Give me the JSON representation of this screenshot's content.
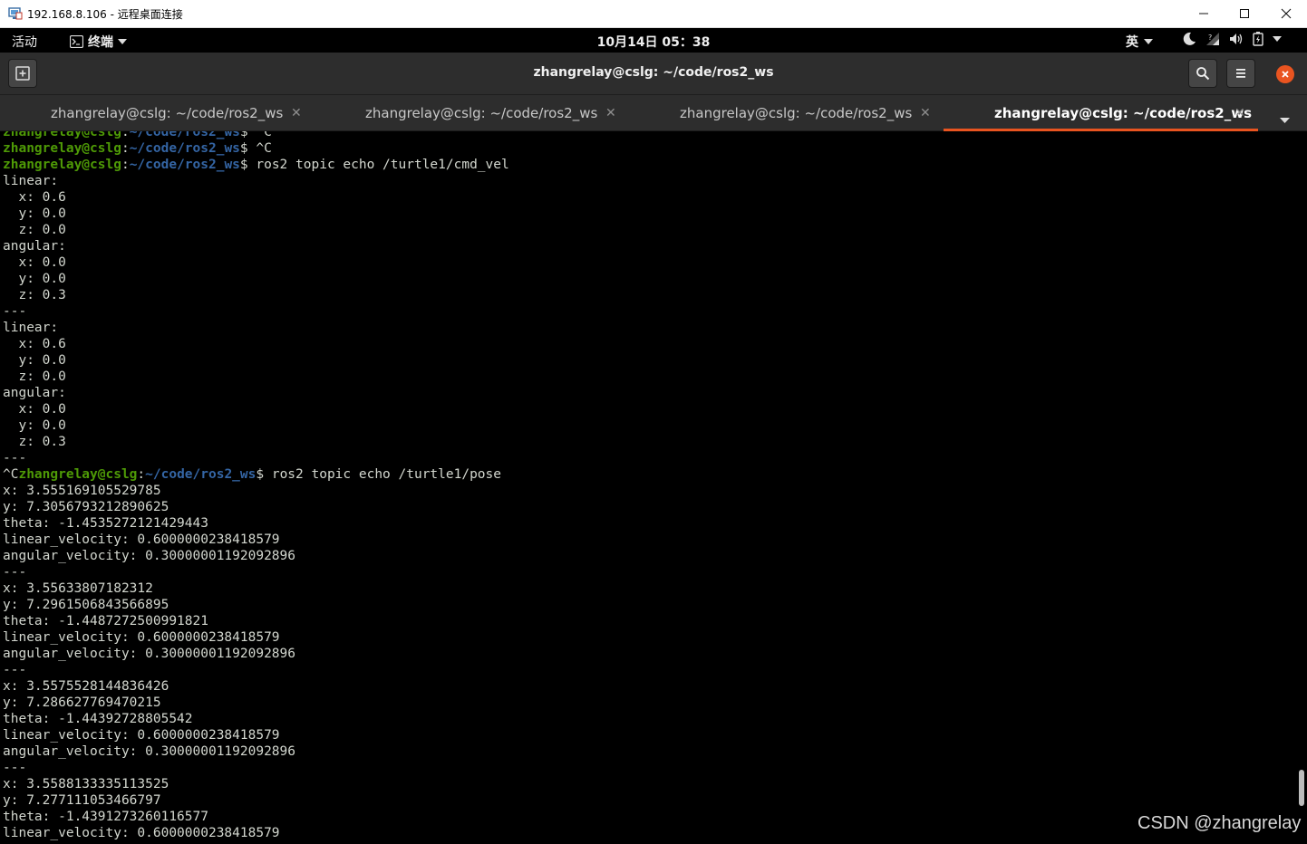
{
  "rdp": {
    "title": "192.168.8.106 - 远程桌面连接",
    "minimize_glyph": "—",
    "maximize_glyph": "☐",
    "close_glyph": "✕"
  },
  "gnome": {
    "activities": "活动",
    "app_name": "终端",
    "clock": "10月14日 05：38",
    "ime": "英"
  },
  "terminal": {
    "title": "zhangrelay@cslg: ~/code/ros2_ws",
    "accent_color": "#e95420",
    "tabs": [
      {
        "label": "zhangrelay@cslg: ~/code/ros2_ws"
      },
      {
        "label": "zhangrelay@cslg: ~/code/ros2_ws"
      },
      {
        "label": "zhangrelay@cslg: ~/code/ros2_ws"
      },
      {
        "label": "zhangrelay@cslg: ~/code/ros2_ws"
      }
    ],
    "active_tab": 3,
    "prompt": {
      "user_host": "zhangrelay@cslg",
      "sep": ":",
      "path": "~/code/ros2_ws",
      "dollar": "$"
    },
    "lines": [
      {
        "type": "prompt",
        "pre": "",
        "cmd": " ^C"
      },
      {
        "type": "prompt",
        "pre": "",
        "cmd": " ^C"
      },
      {
        "type": "prompt",
        "pre": "",
        "cmd": " ros2 topic echo /turtle1/cmd_vel"
      },
      {
        "type": "text",
        "text": "linear:"
      },
      {
        "type": "text",
        "text": "  x: 0.6"
      },
      {
        "type": "text",
        "text": "  y: 0.0"
      },
      {
        "type": "text",
        "text": "  z: 0.0"
      },
      {
        "type": "text",
        "text": "angular:"
      },
      {
        "type": "text",
        "text": "  x: 0.0"
      },
      {
        "type": "text",
        "text": "  y: 0.0"
      },
      {
        "type": "text",
        "text": "  z: 0.3"
      },
      {
        "type": "text",
        "text": "---"
      },
      {
        "type": "text",
        "text": "linear:"
      },
      {
        "type": "text",
        "text": "  x: 0.6"
      },
      {
        "type": "text",
        "text": "  y: 0.0"
      },
      {
        "type": "text",
        "text": "  z: 0.0"
      },
      {
        "type": "text",
        "text": "angular:"
      },
      {
        "type": "text",
        "text": "  x: 0.0"
      },
      {
        "type": "text",
        "text": "  y: 0.0"
      },
      {
        "type": "text",
        "text": "  z: 0.3"
      },
      {
        "type": "text",
        "text": "---"
      },
      {
        "type": "prompt",
        "pre": "^C",
        "cmd": " ros2 topic echo /turtle1/pose"
      },
      {
        "type": "text",
        "text": "x: 3.555169105529785"
      },
      {
        "type": "text",
        "text": "y: 7.3056793212890625"
      },
      {
        "type": "text",
        "text": "theta: -1.4535272121429443"
      },
      {
        "type": "text",
        "text": "linear_velocity: 0.6000000238418579"
      },
      {
        "type": "text",
        "text": "angular_velocity: 0.30000001192092896"
      },
      {
        "type": "text",
        "text": "---"
      },
      {
        "type": "text",
        "text": "x: 3.55633807182312"
      },
      {
        "type": "text",
        "text": "y: 7.2961506843566895"
      },
      {
        "type": "text",
        "text": "theta: -1.4487272500991821"
      },
      {
        "type": "text",
        "text": "linear_velocity: 0.6000000238418579"
      },
      {
        "type": "text",
        "text": "angular_velocity: 0.30000001192092896"
      },
      {
        "type": "text",
        "text": "---"
      },
      {
        "type": "text",
        "text": "x: 3.5575528144836426"
      },
      {
        "type": "text",
        "text": "y: 7.286627769470215"
      },
      {
        "type": "text",
        "text": "theta: -1.44392728805542"
      },
      {
        "type": "text",
        "text": "linear_velocity: 0.6000000238418579"
      },
      {
        "type": "text",
        "text": "angular_velocity: 0.30000001192092896"
      },
      {
        "type": "text",
        "text": "---"
      },
      {
        "type": "text",
        "text": "x: 3.5588133335113525"
      },
      {
        "type": "text",
        "text": "y: 7.277111053466797"
      },
      {
        "type": "text",
        "text": "theta: -1.4391273260116577"
      },
      {
        "type": "text",
        "text": "linear_velocity: 0.6000000238418579"
      }
    ]
  },
  "watermark": "CSDN @zhangrelay"
}
